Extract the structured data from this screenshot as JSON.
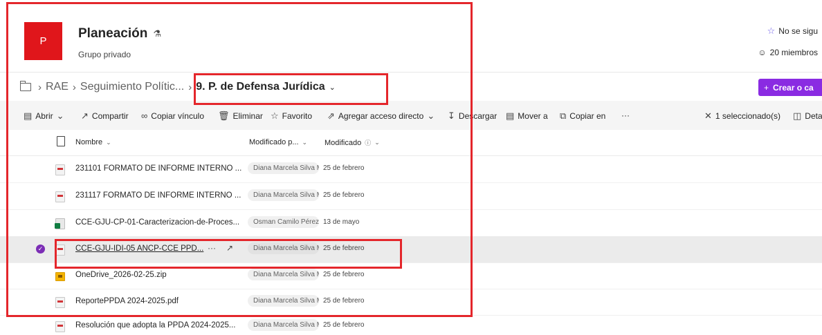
{
  "site": {
    "logo_letter": "P",
    "title": "Planeación",
    "subtitle": "Grupo privado",
    "follow_label": "No se sigu",
    "members_label": "20 miembros"
  },
  "breadcrumb": {
    "items": [
      "RAE",
      "Seguimiento Polític...",
      "9. P. de Defensa Jurídica"
    ]
  },
  "create_button": {
    "label": "Crear o ca"
  },
  "commands": {
    "open": "Abrir",
    "share": "Compartir",
    "copy_link": "Copiar vínculo",
    "delete": "Eliminar",
    "favorite": "Favorito",
    "add_shortcut": "Agregar acceso directo",
    "download": "Descargar",
    "move_to": "Mover a",
    "copy_to": "Copiar en",
    "more": "···",
    "selected": "1 seleccionado(s)",
    "details": "Deta"
  },
  "columns": {
    "name": "Nombre",
    "modified_by": "Modificado p...",
    "modified": "Modificado"
  },
  "files": [
    {
      "type": "pdf",
      "name": "231101 FORMATO DE INFORME INTERNO ...",
      "modified_by": "Diana Marcela Silva M",
      "modified": "25 de febrero",
      "selected": false
    },
    {
      "type": "pdf",
      "name": "231117 FORMATO DE INFORME INTERNO ...",
      "modified_by": "Diana Marcela Silva M",
      "modified": "25 de febrero",
      "selected": false
    },
    {
      "type": "xlsx",
      "name": "CCE-GJU-CP-01-Caracterizacion-de-Proces...",
      "modified_by": "Osman Camilo Pérez S",
      "modified": "13 de mayo",
      "selected": false
    },
    {
      "type": "pdf",
      "name": "CCE-GJU-IDI-05 ANCP-CCE PPD...",
      "modified_by": "Diana Marcela Silva M",
      "modified": "25 de febrero",
      "selected": true
    },
    {
      "type": "zip",
      "name": "OneDrive_2026-02-25.zip",
      "modified_by": "Diana Marcela Silva M",
      "modified": "25 de febrero",
      "selected": false
    },
    {
      "type": "pdf",
      "name": "ReportePPDA 2024-2025.pdf",
      "modified_by": "Diana Marcela Silva M",
      "modified": "25 de febrero",
      "selected": false
    },
    {
      "type": "pdf",
      "name": "Resolución que adopta la PPDA 2024-2025...",
      "modified_by": "Diana Marcela Silva M",
      "modified": "25 de febrero",
      "selected": false
    }
  ],
  "colors": {
    "accent": "#8a2be2",
    "logo": "#e0161b",
    "annotation": "#e4262b"
  }
}
